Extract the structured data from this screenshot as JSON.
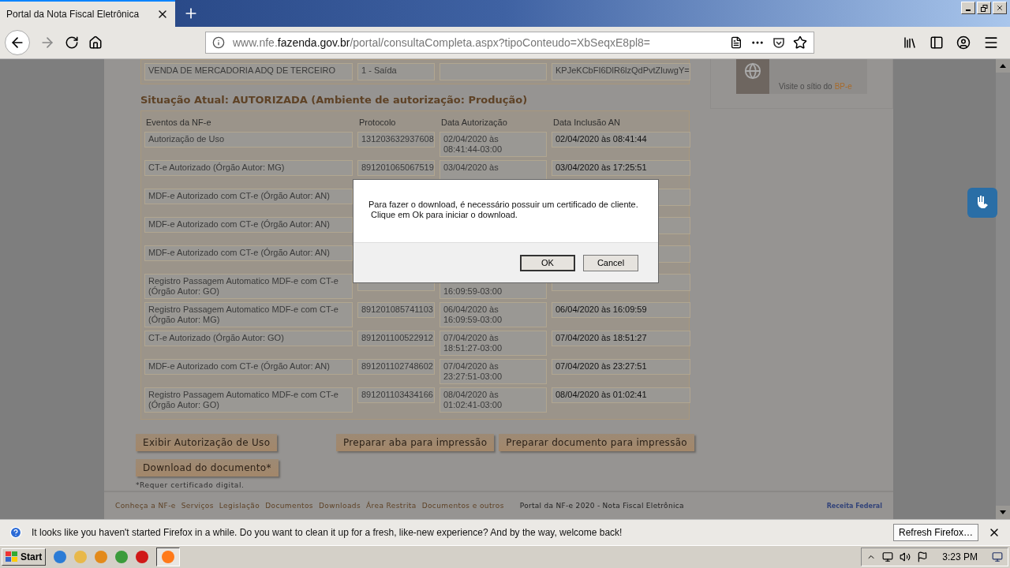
{
  "browser": {
    "tab": {
      "title": "Portal da Nota Fiscal Eletrônica",
      "selected": true
    },
    "url": {
      "prefix": "www.nfe.",
      "domain": "fazenda.gov.br",
      "path": "/portal/consultaCompleta.aspx?tipoConteudo=XbSeqxE8pl8="
    }
  },
  "top_row": [
    "VENDA DE MERCADORIA ADQ DE TERCEIRO",
    "1 - Saída",
    "KPJeKCbFI6DlR6lzQdPvtZluwgY="
  ],
  "status_heading": "Situação Atual: AUTORIZADA (Ambiente de autorização: Produção)",
  "events": {
    "columns": [
      "Eventos da NF-e",
      "Protocolo",
      "Data Autorização",
      "Data Inclusão AN"
    ],
    "rows": [
      {
        "event": "Autorização de Uso",
        "protocol": "131203632937608",
        "auth_line_1": "02/04/2020 às",
        "auth_line_2": "08:41:44-03:00",
        "included": "02/04/2020 às 08:41:44"
      },
      {
        "event": "CT-e Autorizado (Órgão Autor: MG)",
        "protocol": "891201065067519",
        "auth_line_1": "03/04/2020 às",
        "included": "03/04/2020 às 17:25:51"
      },
      {
        "event": "MDF-e Autorizado com CT-e (Órgão Autor: AN)"
      },
      {
        "event": "MDF-e Autorizado com CT-e (Órgão Autor: AN)"
      },
      {
        "event": "MDF-e Autorizado com CT-e (Órgão Autor: AN)"
      },
      {
        "event": "Registro Passagem Automatico MDF-e com CT-e (Órgão Autor: GO)",
        "auth_line_2": "16:09:59-03:00"
      },
      {
        "event": "Registro Passagem Automatico MDF-e com CT-e (Órgão Autor: MG)",
        "protocol": "891201085741103",
        "auth_line_1": "06/04/2020 às",
        "auth_line_2": "16:09:59-03:00",
        "included": "06/04/2020 às 16:09:59"
      },
      {
        "event": "CT-e Autorizado (Órgão Autor: GO)",
        "protocol": "891201100522912",
        "auth_line_1": "07/04/2020 às",
        "auth_line_2": "18:51:27-03:00",
        "included": "07/04/2020 às 18:51:27"
      },
      {
        "event": "MDF-e Autorizado com CT-e (Órgão Autor: AN)",
        "protocol": "891201102748602",
        "auth_line_1": "07/04/2020 às",
        "auth_line_2": "23:27:51-03:00",
        "included": "07/04/2020 às 23:27:51"
      },
      {
        "event": "Registro Passagem Automatico MDF-e com CT-e (Órgão Autor: GO)",
        "protocol": "891201103434166",
        "auth_line_1": "08/04/2020 às",
        "auth_line_2": "01:02:41-03:00",
        "included": "08/04/2020 às 01:02:41"
      }
    ]
  },
  "buttons_left": [
    "Exibir Autorização de Uso"
  ],
  "buttons_right": [
    "Preparar aba para impressão",
    "Preparar documento para impressão"
  ],
  "download_button": "Download do documento*",
  "note": "*Requer certificado digital.",
  "sidebar": {
    "banner_text": "Visite o sítio do",
    "banner_brand": "BP-e"
  },
  "footer": {
    "links": [
      "Conheça a NF-e",
      "Serviços",
      "Legislação",
      "Documentos",
      "Downloads",
      "Área Restrita",
      "Documentos e outros"
    ],
    "copyright": "Portal da NF-e 2020 - Nota Fiscal Eletrônica",
    "logo_text": "Receita Federal"
  },
  "dialog": {
    "lines": [
      "Para fazer o download, é necessário possuir um certificado de cliente.",
      "Clique em Ok para iniciar o download."
    ],
    "buttons": [
      {
        "label": "OK",
        "selected": true
      },
      {
        "label": "Cancel",
        "selected": false
      }
    ]
  },
  "notification": {
    "text": "It looks like you haven't started Firefox in a while. Do you want to clean it up for a fresh, like-new experience? And by the way, welcome back!",
    "button": "Refresh Firefox…"
  },
  "taskbar": {
    "start": "Start",
    "clock": "3:23 PM"
  }
}
